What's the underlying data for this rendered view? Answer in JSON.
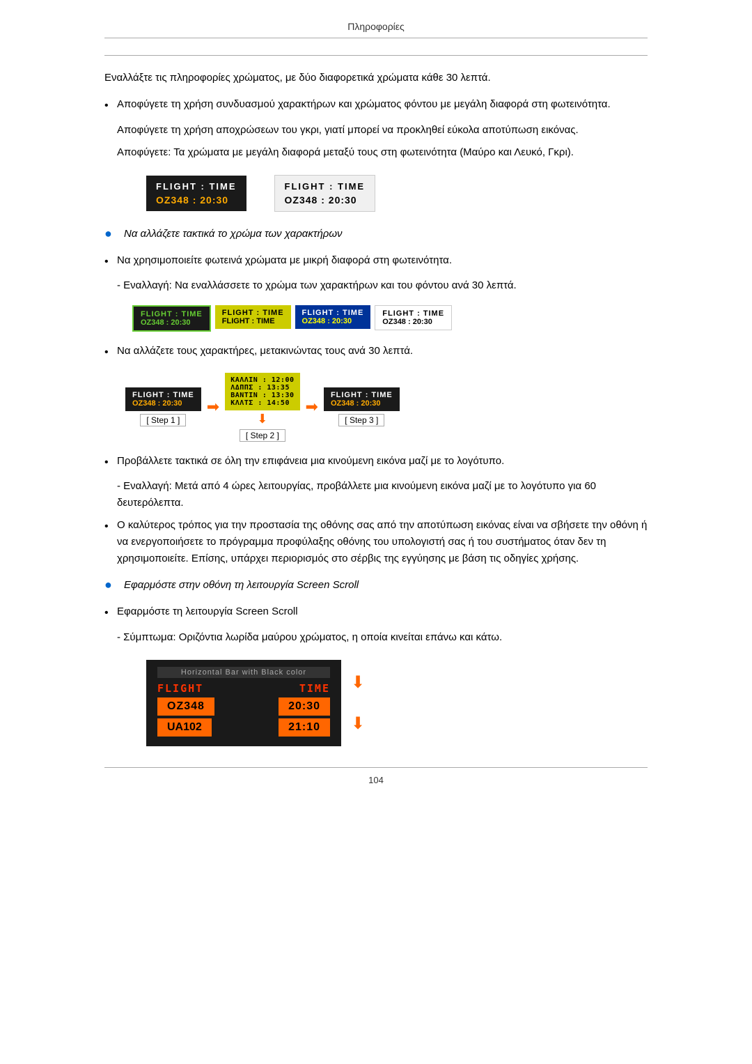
{
  "header": {
    "title": "Πληροφορίες"
  },
  "footer": {
    "page_number": "104"
  },
  "content": {
    "intro": "Εναλλάξτε τις πληροφορίες χρώματος, με δύο διαφορετικά χρώματα κάθε 30 λεπτά.",
    "bullet1": {
      "text": "Αποφύγετε τη χρήση συνδυασμού χαρακτήρων και χρώματος φόντου με μεγάλη διαφορά στη φωτεινότητα."
    },
    "sub1": "Αποφύγετε τη χρήση αποχρώσεων του γκρι, γιατί μπορεί να προκληθεί εύκολα αποτύπωση εικόνας.",
    "sub2": "Αποφύγετε: Τα χρώματα με μεγάλη διαφορά μεταξύ τους στη φωτεινότητα (Μαύρο και Λευκό, Γκρι).",
    "display_dark": {
      "header": "FLIGHT  :  TIME",
      "data": "OZ348   :  20:30"
    },
    "display_light": {
      "header": "FLIGHT  :  TIME",
      "data": "OZ348   :  20:30"
    },
    "blue_note1": "Να αλλάζετε τακτικά το χρώμα των χαρακτήρων",
    "bullet2": "Να χρησιμοποιείτε φωτεινά χρώματα με μικρή διαφορά στη φωτεινότητα.",
    "sub3": "- Εναλλαγή: Να εναλλάσσετε το χρώμα των χαρακτήρων και του φόντου ανά 30 λεπτά.",
    "color_boxes": [
      {
        "hdr": "FLIGHT  :  TIME",
        "dta": "OZ348  :  20:30",
        "type": "green"
      },
      {
        "hdr": "FLIGHT  :  TIME",
        "dta": "FLIGHT  :  TIME",
        "type": "yellow"
      },
      {
        "hdr": "FLIGHT  :  TIME",
        "dta": "OZ348  :  20:30",
        "type": "blue"
      },
      {
        "hdr": "FLIGHT  :  TIME",
        "dta": "OZ348  :  20:30",
        "type": "white"
      }
    ],
    "bullet3": "Να αλλάζετε τους χαρακτήρες, μετακινώντας τους ανά 30 λεπτά.",
    "step1_label": "[ Step 1 ]",
    "step2_label": "[ Step 2 ]",
    "step3_label": "[ Step 3 ]",
    "step1_hdr": "FLIGHT  :  TIME",
    "step1_dta": "OZ348  :  20:30",
    "step2_line1": "ΚΑΛΛΙΝ : 12:00",
    "step2_line2": "ΛΔΠΠΣ  :  13:35",
    "step2_line3": "ΒΑΝΤΙΝ : 13:30",
    "step2_line4": "ΚΛΛΤΣ  :  14:50",
    "step3_hdr": "FLIGHT  :  TIME",
    "step3_dta": "OZ348  :  20:30",
    "bullet4": "Προβάλλετε τακτικά σε όλη την επιφάνεια μια κινούμενη εικόνα μαζί με το λογότυπο.",
    "sub4": "- Εναλλαγή: Μετά από 4 ώρες λειτουργίας, προβάλλετε μια κινούμενη εικόνα μαζί με το λογότυπο για 60 δευτερόλεπτα.",
    "bullet5": "Ο καλύτερος τρόπος για την προστασία της οθόνης σας από την αποτύπωση εικόνας είναι να σβήσετε την οθόνη ή να ενεργοποιήσετε το πρόγραμμα προφύλαξης οθόνης του υπολογιστή σας ή του συστήματος όταν δεν τη χρησιμοποιείτε. Επίσης, υπάρχει περιορισμός στο σέρβις της εγγύησης με βάση τις οδηγίες χρήσης.",
    "blue_note2": "Εφαρμόστε στην οθόνη τη λειτουργία Screen Scroll",
    "bullet6": "Εφαρμόστε τη λειτουργία Screen Scroll",
    "sub5": "- Σύμπτωμα: Οριζόντια λωρίδα μαύρου χρώματος, η οποία κινείται επάνω και κάτω.",
    "scroll_header": "Horizontal Bar with Black color",
    "scroll_col1_hdr": "FLIGHT",
    "scroll_col2_hdr": "TIME",
    "scroll_r1c1": "OZ348",
    "scroll_r1c2": "20:30",
    "scroll_r2c1": "UA102",
    "scroll_r2c2": "21:10"
  }
}
